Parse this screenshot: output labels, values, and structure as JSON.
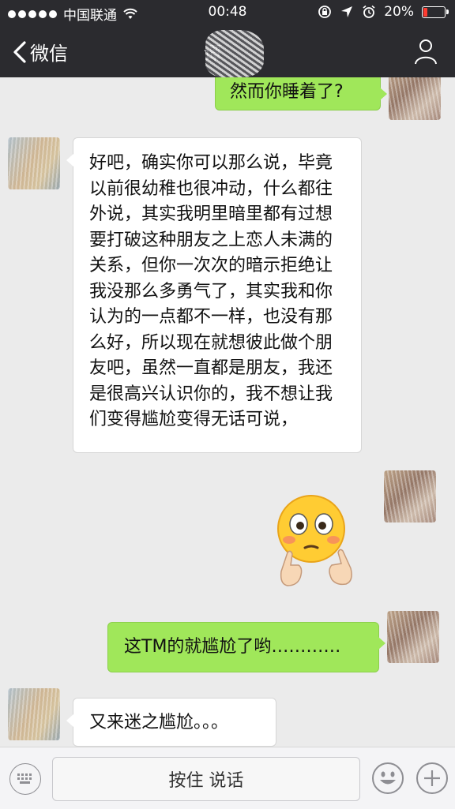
{
  "status_bar": {
    "carrier": "中国联通",
    "time": "00:48",
    "battery": "20%",
    "battery_color": "#ff3b30"
  },
  "nav": {
    "back_label": "微信",
    "title": "谭"
  },
  "messages": [
    {
      "side": "right",
      "text": "然而你睡着了?"
    },
    {
      "side": "left",
      "text": "好吧，确实你可以那么说，毕竟以前很幼稚也很冲动，什么都往外说，其实我明里暗里都有过想要打破这种朋友之上恋人未满的关系，但你一次次的暗示拒绝让我没那么多勇气了，其实我和你认为的一点都不一样，也没有那么好，所以现在就想彼此做个朋友吧，虽然一直都是朋友，我还是很高兴认识你的，我不想让我们变得尴尬变得无话可说，"
    },
    {
      "side": "right",
      "type": "emoji",
      "text": "😳👉👈"
    },
    {
      "side": "right",
      "text": "这TM的就尴尬了哟…………"
    },
    {
      "side": "left",
      "text": "又来迷之尴尬。。。"
    }
  ],
  "input": {
    "hold_to_talk": "按住 说话"
  },
  "icons": {
    "back": "chevron-left-icon",
    "profile": "person-icon",
    "keyboard": "keyboard-icon",
    "emoji": "smiley-icon",
    "plus": "plus-icon"
  },
  "colors": {
    "nav_bg": "#2b2b2f",
    "chat_bg": "#ebebeb",
    "sent_bubble": "#a0e75a",
    "received_bubble": "#ffffff"
  }
}
